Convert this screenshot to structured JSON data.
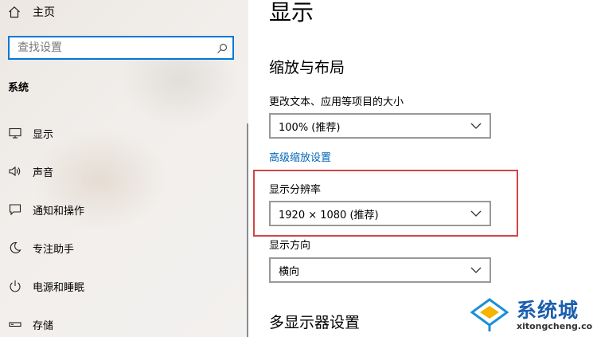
{
  "sidebar": {
    "home_label": "主页",
    "search_placeholder": "查找设置",
    "section": "系统",
    "items": [
      {
        "label": "显示",
        "icon": "monitor-icon"
      },
      {
        "label": "声音",
        "icon": "speaker-icon"
      },
      {
        "label": "通知和操作",
        "icon": "notification-icon"
      },
      {
        "label": "专注助手",
        "icon": "moon-icon"
      },
      {
        "label": "电源和睡眠",
        "icon": "power-icon"
      },
      {
        "label": "存储",
        "icon": "storage-icon"
      }
    ]
  },
  "main": {
    "title": "显示",
    "scale_section": "缩放与布局",
    "scale_label": "更改文本、应用等项目的大小",
    "scale_value": "100% (推荐)",
    "advanced_link": "高级缩放设置",
    "resolution_label": "显示分辨率",
    "resolution_value": "1920 × 1080 (推荐)",
    "orientation_label": "显示方向",
    "orientation_value": "横向",
    "multi_display_section": "多显示器设置"
  },
  "watermark": {
    "name": "系统城",
    "url": "xitongcheng.com"
  },
  "colors": {
    "accent": "#0078d7",
    "link": "#0067b8",
    "highlight_border": "#d04545"
  }
}
